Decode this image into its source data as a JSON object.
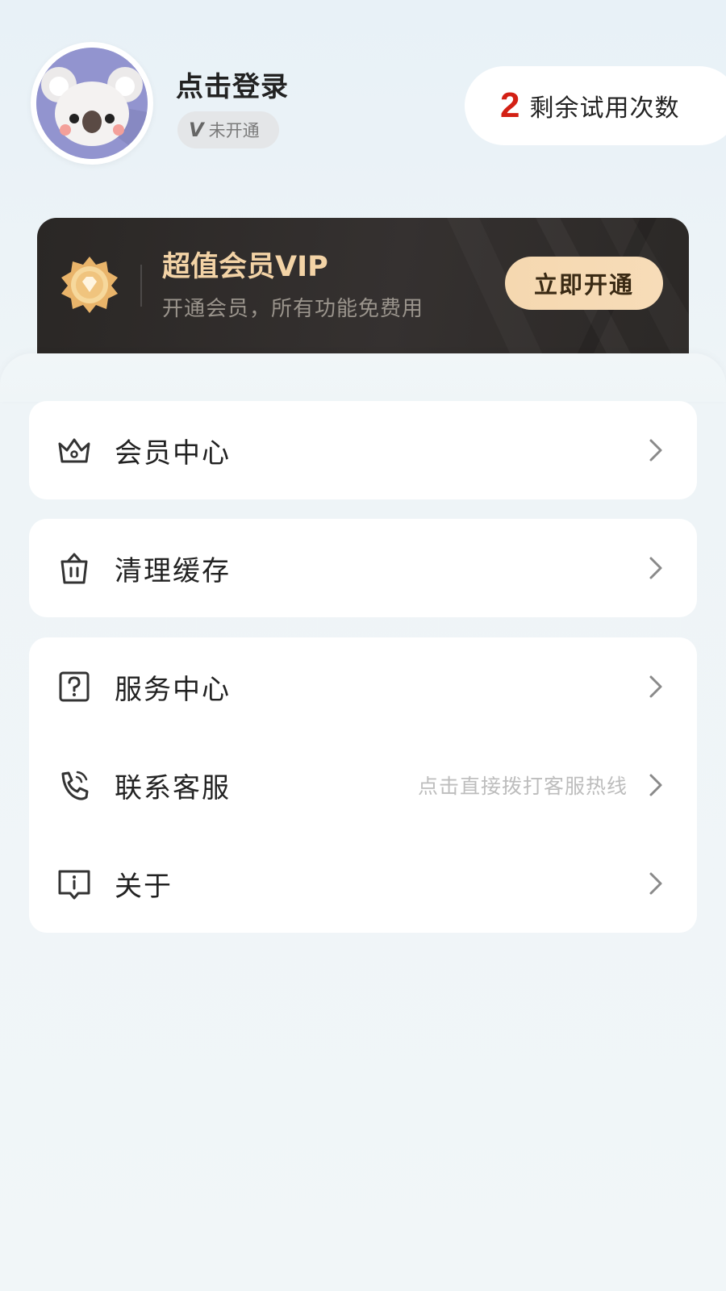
{
  "profile": {
    "login_label": "点击登录",
    "vip_badge_letter": "V",
    "vip_status": "未开通"
  },
  "trial": {
    "count": "2",
    "label": "剩余试用次数"
  },
  "vip_card": {
    "title": "超值会员VIP",
    "subtitle": "开通会员，所有功能免费用",
    "button_label": "立即开通",
    "accent_color": "#f3d3a6",
    "background_color": "#2f2b29"
  },
  "menu": {
    "member_center": {
      "label": "会员中心",
      "icon": "crown-icon"
    },
    "clear_cache": {
      "label": "清理缓存",
      "icon": "trash-icon"
    },
    "service_center": {
      "label": "服务中心",
      "icon": "question-icon"
    },
    "contact_support": {
      "label": "联系客服",
      "hint": "点击直接拨打客服热线",
      "icon": "phone-icon"
    },
    "about": {
      "label": "关于",
      "icon": "info-icon"
    }
  },
  "colors": {
    "trial_number": "#d32014",
    "hint_text": "#bdbdbd"
  }
}
